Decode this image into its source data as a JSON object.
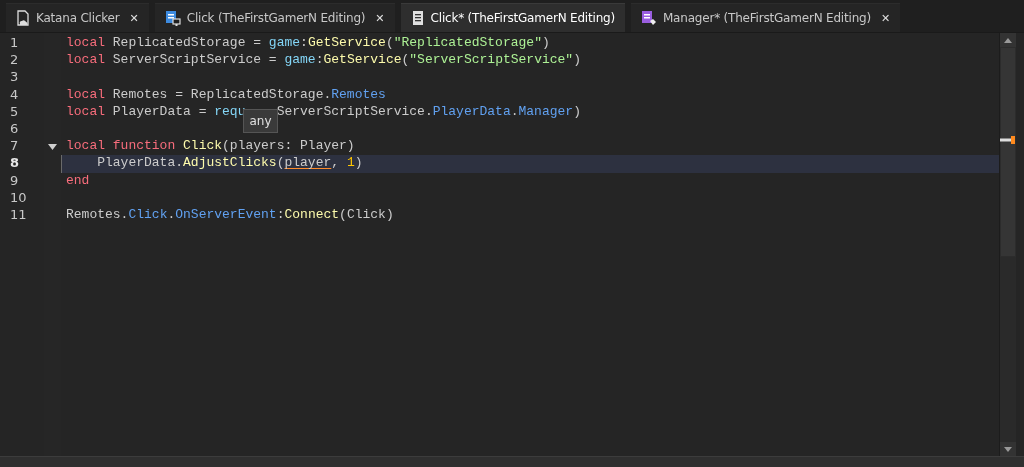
{
  "tabs": [
    {
      "label": "Katana Clicker",
      "kind": "local",
      "selected": false
    },
    {
      "label": "Click (TheFirstGamerN Editing)",
      "kind": "server",
      "selected": false
    },
    {
      "label": "Click* (TheFirstGamerN Editing)",
      "kind": "plain",
      "selected": true
    },
    {
      "label": "Manager* (TheFirstGamerN Editing)",
      "kind": "module",
      "selected": false
    }
  ],
  "close_glyph": "✕",
  "code": {
    "lines": [
      {
        "number": "1",
        "current": false,
        "expanded": false,
        "tokens": [
          {
            "kind": "keyword",
            "text": "local"
          },
          {
            "kind": "plain",
            "text": " ReplicatedStorage = "
          },
          {
            "kind": "builtin",
            "text": "game"
          },
          {
            "kind": "plain",
            "text": ":"
          },
          {
            "kind": "call",
            "text": "GetService"
          },
          {
            "kind": "plain",
            "text": "("
          },
          {
            "kind": "string",
            "text": "\"ReplicatedStorage\""
          },
          {
            "kind": "plain",
            "text": ")"
          }
        ]
      },
      {
        "number": "2",
        "current": false,
        "expanded": false,
        "tokens": [
          {
            "kind": "keyword",
            "text": "local"
          },
          {
            "kind": "plain",
            "text": " ServerScriptService = "
          },
          {
            "kind": "builtin",
            "text": "game"
          },
          {
            "kind": "plain",
            "text": ":"
          },
          {
            "kind": "call",
            "text": "GetService"
          },
          {
            "kind": "plain",
            "text": "("
          },
          {
            "kind": "string",
            "text": "\"ServerScriptService\""
          },
          {
            "kind": "plain",
            "text": ")"
          }
        ]
      },
      {
        "number": "3",
        "current": false,
        "expanded": false
      },
      {
        "number": "4",
        "current": false,
        "expanded": false,
        "tokens": [
          {
            "kind": "keyword",
            "text": "local"
          },
          {
            "kind": "plain",
            "text": " Remotes = ReplicatedStorage."
          },
          {
            "kind": "member",
            "text": "Remotes"
          }
        ]
      },
      {
        "number": "5",
        "current": false,
        "expanded": false,
        "tokens": [
          {
            "kind": "keyword",
            "text": "local"
          },
          {
            "kind": "plain",
            "text": " PlayerData = "
          },
          {
            "kind": "builtin",
            "text": "requ"
          },
          {
            "kind": "covered",
            "tooltip": "any"
          },
          {
            "kind": "plain",
            "text": "ServerScriptService."
          },
          {
            "kind": "member",
            "text": "PlayerData"
          },
          {
            "kind": "plain",
            "text": "."
          },
          {
            "kind": "member",
            "text": "Manager"
          },
          {
            "kind": "plain",
            "text": ")"
          }
        ]
      },
      {
        "number": "6",
        "current": false,
        "expanded": false
      },
      {
        "number": "7",
        "current": false,
        "expanded": true,
        "tokens": [
          {
            "kind": "keyword",
            "text": "local function "
          },
          {
            "kind": "call",
            "text": "Click"
          },
          {
            "kind": "plain",
            "text": "(players: Player)"
          }
        ]
      },
      {
        "number": "8",
        "current": true,
        "expanded": false,
        "tokens": [
          {
            "kind": "plain",
            "text": "    PlayerData."
          },
          {
            "kind": "call",
            "text": "AdjustClicks"
          },
          {
            "kind": "plain",
            "text": "("
          },
          {
            "kind": "warning",
            "text": "player"
          },
          {
            "kind": "plain",
            "text": ", "
          },
          {
            "kind": "number",
            "text": "1"
          },
          {
            "kind": "plain",
            "text": ")"
          }
        ]
      },
      {
        "number": "9",
        "current": false,
        "expanded": false,
        "tokens": [
          {
            "kind": "keyword",
            "text": "end"
          }
        ]
      },
      {
        "number": "10",
        "current": false,
        "expanded": false
      },
      {
        "number": "11",
        "current": false,
        "expanded": false,
        "tokens": [
          {
            "kind": "plain",
            "text": "Remotes."
          },
          {
            "kind": "member",
            "text": "Click"
          },
          {
            "kind": "plain",
            "text": "."
          },
          {
            "kind": "member",
            "text": "OnServerEvent"
          },
          {
            "kind": "plain",
            "text": ":"
          },
          {
            "kind": "call",
            "text": "Connect"
          },
          {
            "kind": "plain",
            "text": "(Click)"
          }
        ]
      }
    ]
  }
}
